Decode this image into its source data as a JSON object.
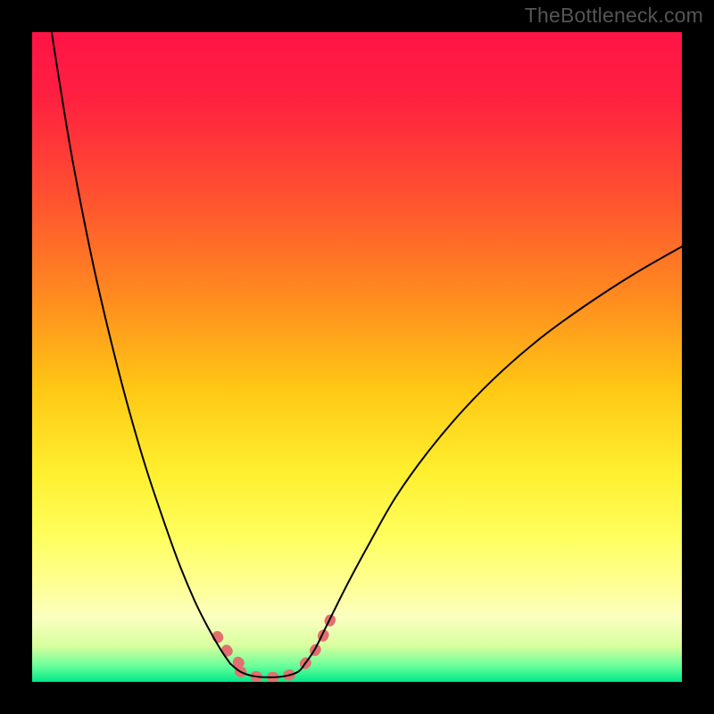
{
  "attribution": "TheBottleneck.com",
  "chart_data": {
    "type": "line",
    "title": "",
    "xlabel": "",
    "ylabel": "",
    "xlim": [
      0,
      100
    ],
    "ylim": [
      0,
      100
    ],
    "gradient_stops": [
      {
        "offset": 0.0,
        "color": "#ff1446"
      },
      {
        "offset": 0.1,
        "color": "#ff2040"
      },
      {
        "offset": 0.25,
        "color": "#ff5030"
      },
      {
        "offset": 0.4,
        "color": "#ff8820"
      },
      {
        "offset": 0.55,
        "color": "#ffc814"
      },
      {
        "offset": 0.68,
        "color": "#fff030"
      },
      {
        "offset": 0.78,
        "color": "#ffff60"
      },
      {
        "offset": 0.86,
        "color": "#fdff9a"
      },
      {
        "offset": 0.9,
        "color": "#fbffc0"
      },
      {
        "offset": 0.945,
        "color": "#d8ff9e"
      },
      {
        "offset": 0.975,
        "color": "#6aff9a"
      },
      {
        "offset": 1.0,
        "color": "#00e889"
      }
    ],
    "series": [
      {
        "name": "left-descending-curve",
        "x": [
          3.0,
          4.5,
          6.0,
          8.0,
          10.0,
          12.5,
          15.0,
          17.5,
          20.0,
          22.5,
          25.0,
          27.0,
          29.0,
          30.5
        ],
        "values": [
          100,
          90.5,
          81.5,
          71.0,
          61.5,
          51.0,
          41.5,
          33.0,
          25.5,
          18.5,
          12.5,
          8.5,
          5.0,
          2.8
        ]
      },
      {
        "name": "right-ascending-curve",
        "x": [
          42.0,
          43.5,
          45.5,
          48.5,
          52.0,
          56.0,
          61.0,
          66.5,
          72.5,
          79.0,
          86.0,
          93.0,
          100.0
        ],
        "values": [
          2.8,
          5.0,
          9.0,
          15.0,
          21.5,
          28.5,
          35.5,
          42.0,
          48.0,
          53.5,
          58.5,
          63.0,
          67.0
        ]
      },
      {
        "name": "bottom-u-flat",
        "x": [
          30.5,
          32.0,
          34.0,
          36.5,
          39.0,
          41.0,
          42.0
        ],
        "values": [
          2.8,
          1.6,
          0.9,
          0.7,
          0.9,
          1.6,
          2.8
        ]
      }
    ],
    "highlight_segments": [
      {
        "name": "left-highlight",
        "x": [
          28.5,
          30.0,
          31.0,
          32.0,
          33.0
        ],
        "values": [
          7.0,
          4.8,
          3.7,
          2.8,
          2.1
        ]
      },
      {
        "name": "bottom-highlight",
        "x": [
          32.0,
          34.0,
          36.5,
          39.0,
          41.0
        ],
        "values": [
          1.6,
          0.9,
          0.7,
          0.9,
          1.6
        ]
      },
      {
        "name": "right-highlight",
        "x": [
          42.0,
          43.0,
          44.5,
          46.0
        ],
        "values": [
          2.8,
          4.0,
          6.5,
          9.8
        ]
      }
    ],
    "styles": {
      "curve_color": "#000000",
      "curve_width": 2.0,
      "highlight_color": "#e27070",
      "highlight_width": 12,
      "highlight_dash": "1.5 17"
    }
  }
}
